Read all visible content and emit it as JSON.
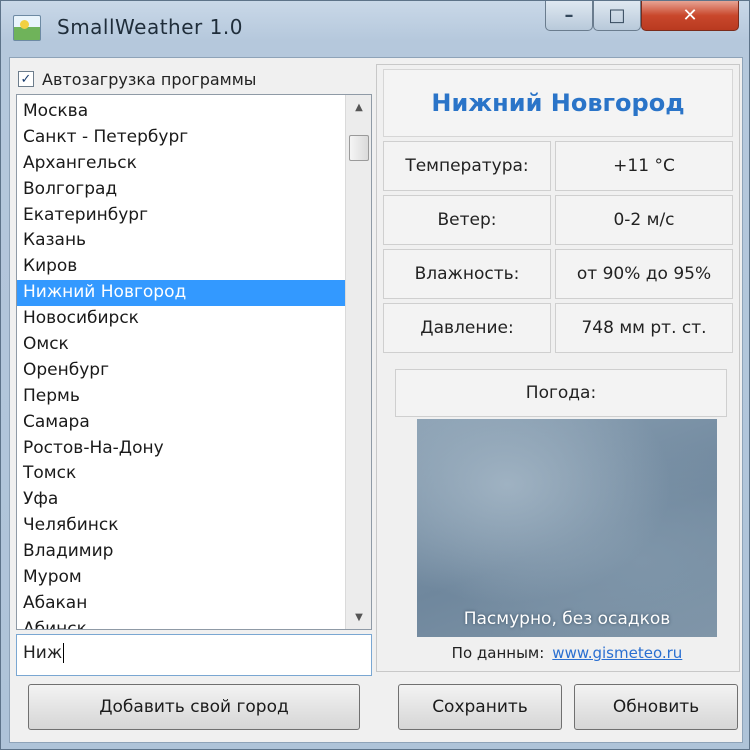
{
  "window": {
    "title": "SmallWeather 1.0",
    "controls": {
      "minimize": "–",
      "maximize": "□",
      "close": "✕"
    }
  },
  "sidebar": {
    "autoload_label": "Автозагрузка программы",
    "autoload_checked": true,
    "cities": [
      "Москва",
      "Санкт - Петербург",
      "Архангельск",
      "Волгоград",
      "Екатеринбург",
      "Казань",
      "Киров",
      "Нижний Новгород",
      "Новосибирск",
      "Омск",
      "Оренбург",
      "Пермь",
      "Самара",
      "Ростов-На-Дону",
      "Томск",
      "Уфа",
      "Челябинск",
      "Владимир",
      "Муром",
      "Абакан",
      "Абинск"
    ],
    "selected_city": "Нижний Новгород",
    "search_value": "Ниж",
    "add_city_button": "Добавить свой город"
  },
  "weather": {
    "city": "Нижний Новгород",
    "rows": [
      {
        "label": "Температура:",
        "value": "+11 °С"
      },
      {
        "label": "Ветер:",
        "value": "0-2 м/с"
      },
      {
        "label": "Влажность:",
        "value": "от 90% до 95%"
      },
      {
        "label": "Давление:",
        "value": "748 мм рт. ст."
      }
    ],
    "section_label": "Погода:",
    "description": "Пасмурно, без осадков",
    "source_prefix": "По данным:",
    "source_link": "www.gismeteo.ru"
  },
  "buttons": {
    "save": "Сохранить",
    "refresh": "Обновить"
  },
  "colors": {
    "accent": "#2a74c8",
    "selection": "#3399ff",
    "close_button": "#c9472c"
  }
}
